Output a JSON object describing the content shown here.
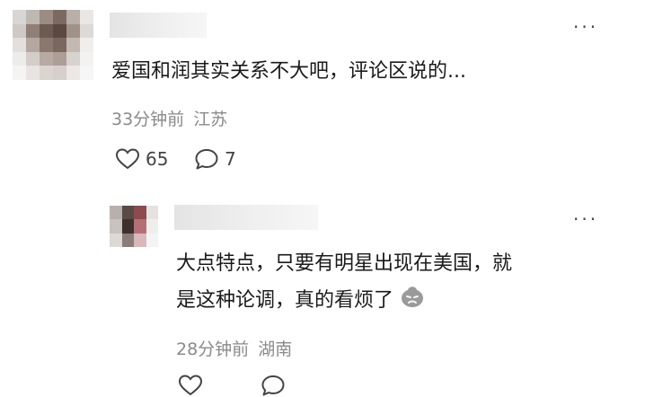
{
  "comment": {
    "text": "爱国和润其实关系不大吧，评论区说的...",
    "time": "33分钟前",
    "location": "江苏",
    "likes": "65",
    "replies": "7",
    "more_label": "···",
    "icons": [
      "heart-icon",
      "comment-icon",
      "more-icon"
    ]
  },
  "reply": {
    "line1": "大点特点，只要有明星出现在美国，就",
    "line2": "是这种论调，真的看烦了",
    "time": "28分钟前",
    "location": "湖南",
    "more_label": "···",
    "icons": [
      "annoyed-emoji-icon",
      "heart-icon",
      "comment-icon",
      "more-icon"
    ]
  },
  "colors": {
    "text": "#1a1a1a",
    "meta": "#8a8a8a",
    "icon": "#444444",
    "avatar_main": [
      "#d8d6d4",
      "#bfb7b2",
      "#9b8c84",
      "#7c6a60",
      "#b9aea8",
      "#e9e7e5",
      "#cfc9c5",
      "#8f7f77",
      "#6d5a50",
      "#5b4840",
      "#a0918a",
      "#dcd9d7",
      "#e2dfdd",
      "#b3a7a0",
      "#8a776d",
      "#7a675d",
      "#c3b8b2",
      "#efeeed",
      "#eeeceb",
      "#d4cdc9",
      "#b6aaa3",
      "#ad9f98",
      "#d9d3cf",
      "#f3f2f1",
      "#f5f4f3",
      "#e7e4e2",
      "#dad4d0",
      "#d6cfcb",
      "#ebe8e6",
      "#f7f6f6"
    ],
    "avatar_reply": [
      "#b8b0ac",
      "#5a4a44",
      "#8d4a4f",
      "#e6e2e0",
      "#c9c3c0",
      "#3e302c",
      "#b46f76",
      "#f0eeed",
      "#ddd9d7",
      "#8a7d78",
      "#d8b8bb",
      "#f5f4f4"
    ]
  }
}
